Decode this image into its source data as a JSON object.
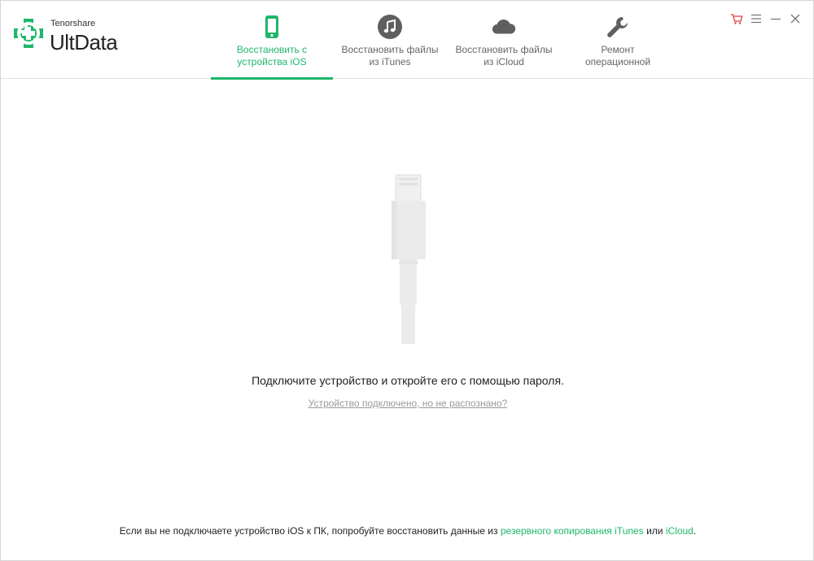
{
  "app": {
    "brand_small": "Tenorshare",
    "brand_name": "UltData"
  },
  "tabs": [
    {
      "line1": "Восстановить с",
      "line2": "устройства iOS",
      "icon": "phone-icon",
      "active": true
    },
    {
      "line1": "Восстановить файлы",
      "line2": "из iTunes",
      "icon": "music-icon",
      "active": false
    },
    {
      "line1": "Восстановить файлы",
      "line2": "из iCloud",
      "icon": "cloud-icon",
      "active": false
    },
    {
      "line1": "Ремонт",
      "line2": "операционной",
      "icon": "wrench-icon",
      "active": false
    }
  ],
  "window_controls": [
    "cart-icon",
    "menu-icon",
    "minimize-icon",
    "close-icon"
  ],
  "main": {
    "message": "Подключите устройство и откройте его с помощью пароля.",
    "help_link": "Устройство подключено, но не распознано?"
  },
  "footer": {
    "prefix": "Если вы не подключаете устройство iOS к ПК, попробуйте восстановить данные из",
    "itunes_link": "резервного копирования iTunes",
    "middle": "или",
    "icloud_link": "iCloud",
    "suffix": "."
  },
  "colors": {
    "accent": "#1fb76b",
    "cart": "#e0403a",
    "icon_gray": "#5f5f5f"
  }
}
